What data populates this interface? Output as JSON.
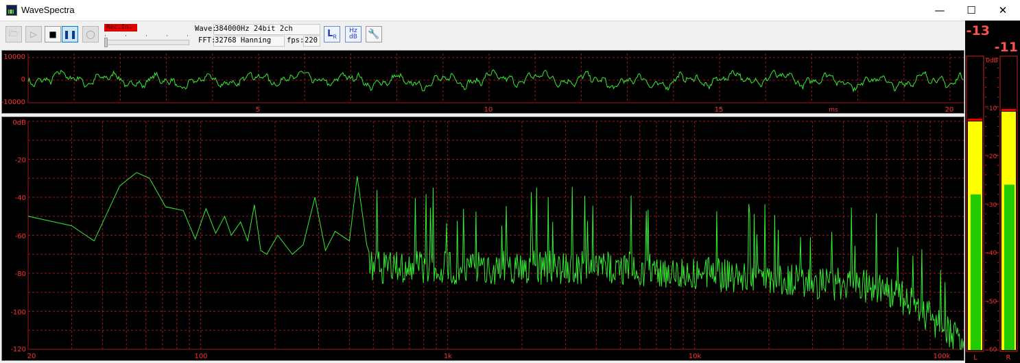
{
  "window": {
    "title": "WaveSpectra",
    "minimize": "—",
    "maximize": "☐",
    "close": "✕"
  },
  "toolbar": {
    "rec_label": "Rec.In.",
    "wave_label": "Wave:",
    "wave_value": "384000Hz 24bit 2ch",
    "fft_label": "FFT:",
    "fft_value": "32768 Hanning",
    "fps_label": "fps:",
    "fps_value": "220",
    "buttons": {
      "open": "open-icon",
      "play": "play-icon",
      "stop": "stop-icon",
      "pause": "pause-icon",
      "record": "record-icon",
      "lr": "lr-icon",
      "hzdb": "hz-db-icon",
      "settings": "wrench-icon"
    }
  },
  "waveform": {
    "y_ticks": [
      "10000",
      "0",
      "-10000"
    ],
    "x_ticks": [
      "5",
      "10",
      "15",
      "20"
    ],
    "x_unit": "ms"
  },
  "spectrum": {
    "y_ticks": [
      "0dB",
      "-20",
      "-40",
      "-60",
      "-80",
      "-100",
      "-120"
    ],
    "x_ticks": [
      "20",
      "100",
      "1k",
      "10k",
      "100k"
    ]
  },
  "meter": {
    "peak_left": "-13",
    "peak_right": "-11",
    "scale": [
      "0dB",
      "-10",
      "-20",
      "-30",
      "-40",
      "-50",
      "-60"
    ],
    "label_left": "L",
    "label_right": "R",
    "left_rms_db": -28,
    "left_peak_db": -13,
    "right_rms_db": -26,
    "right_peak_db": -11
  },
  "colors": {
    "trace": "#33ee33",
    "grid": "#a01818",
    "axis_text": "#ff3030",
    "meter_yellow": "#ffff00",
    "meter_green": "#22cc00",
    "meter_peak": "#ff0000"
  }
}
